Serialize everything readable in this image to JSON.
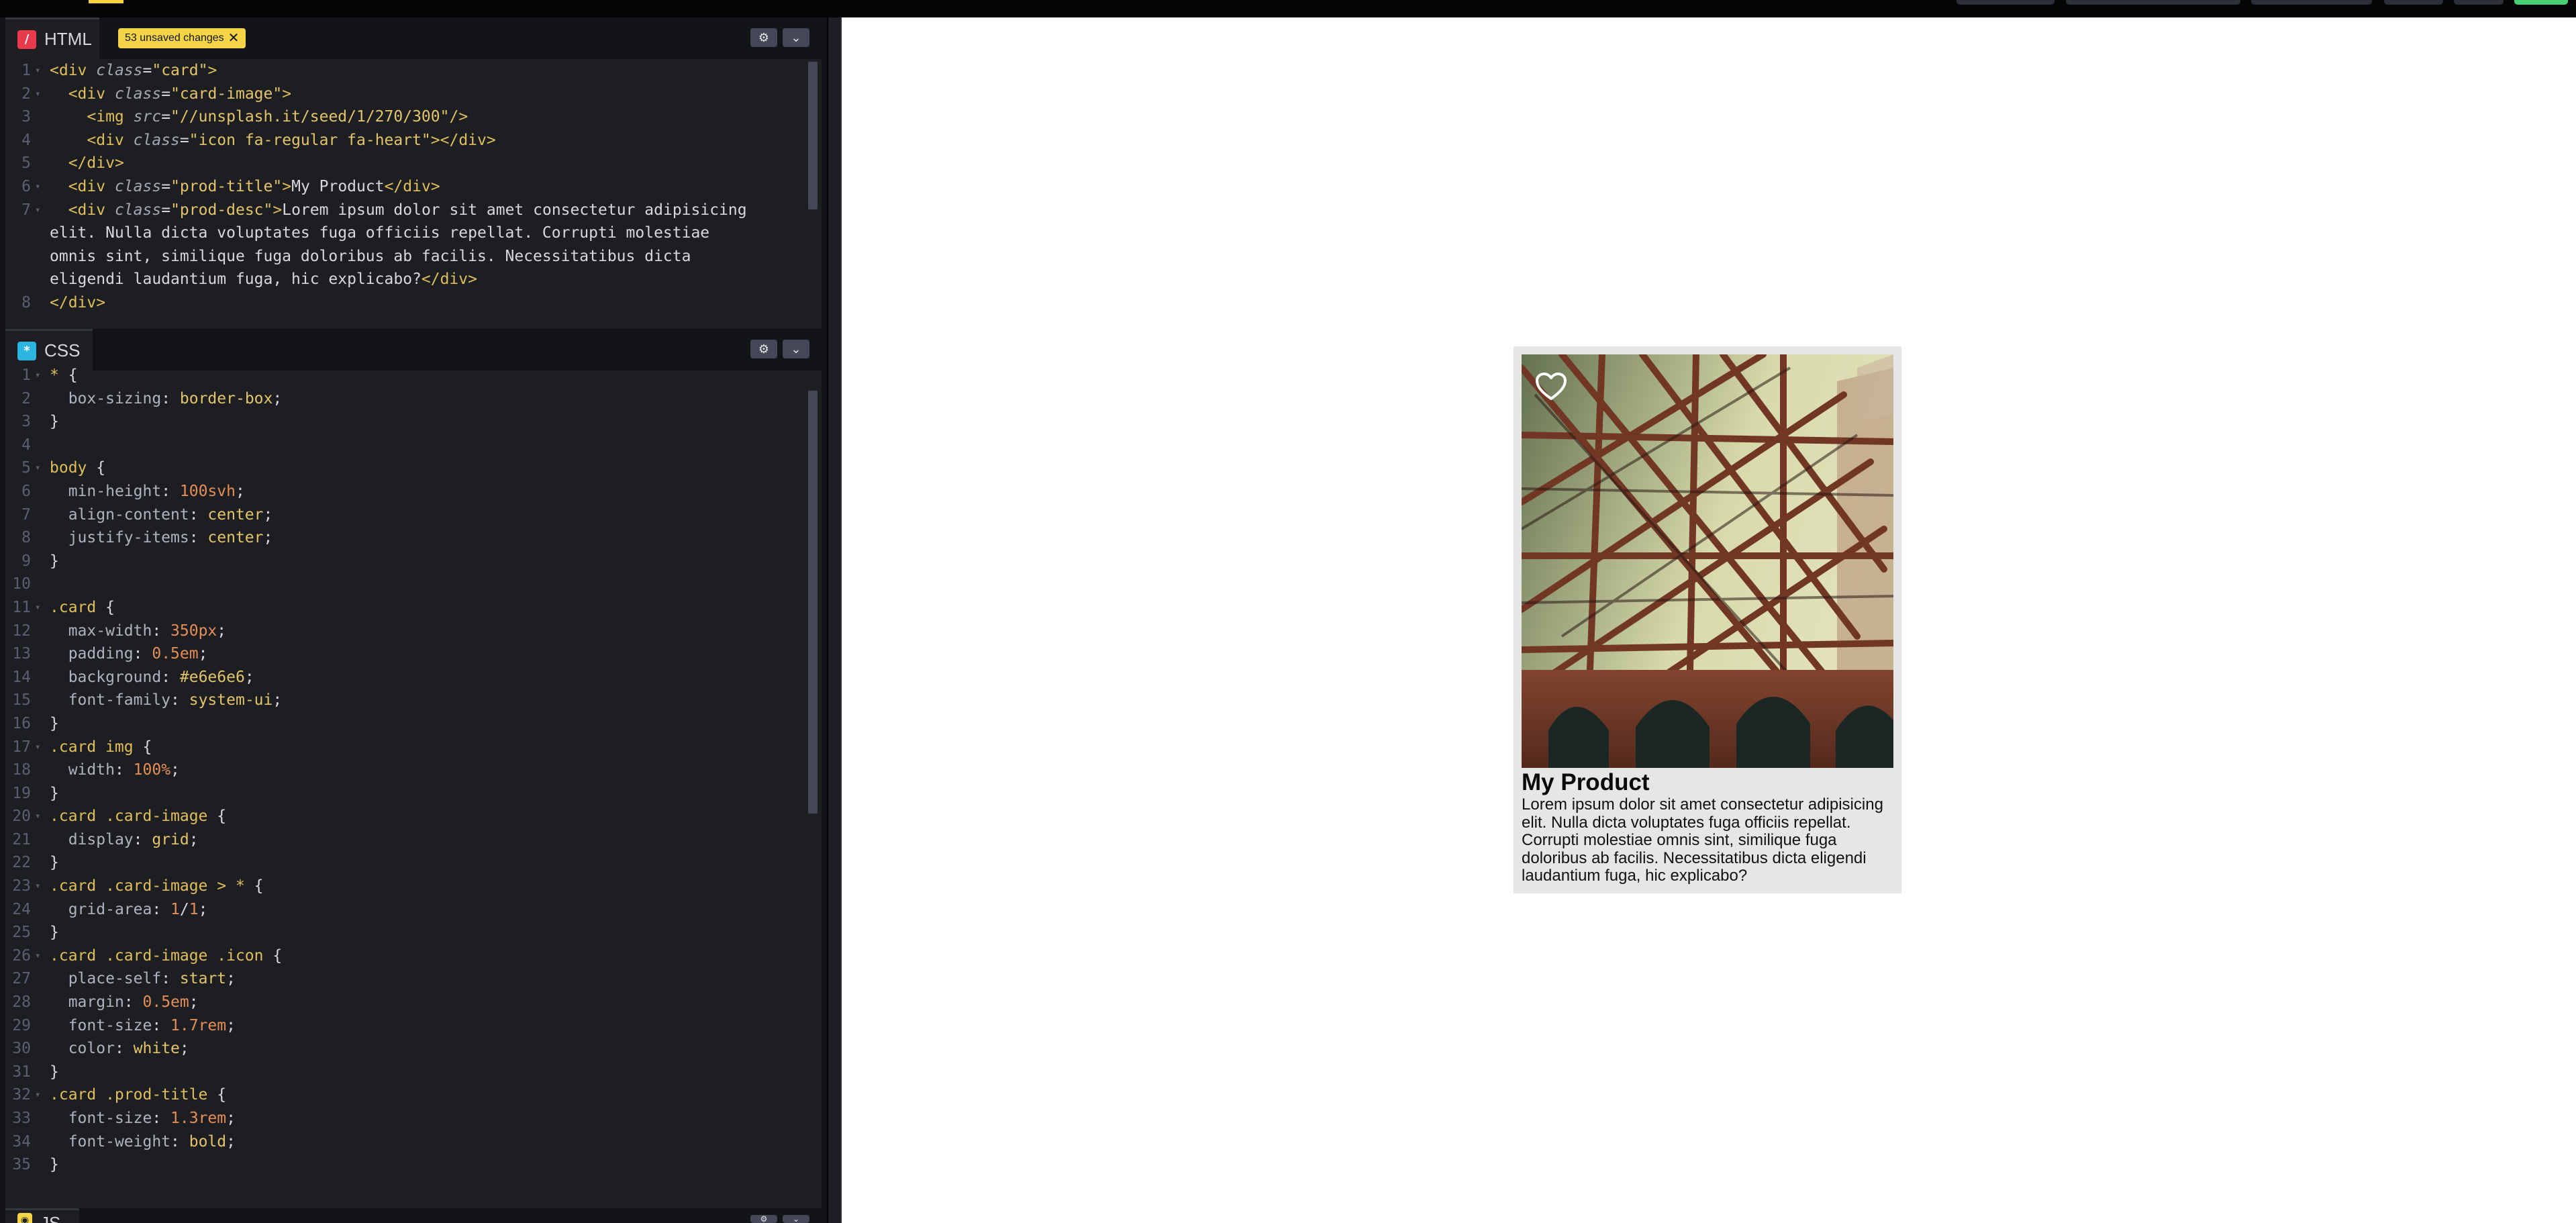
{
  "editors": {
    "html": {
      "name": "HTML",
      "icon": "slash-icon",
      "icon_color": "#e9394c",
      "badge": "53 unsaved changes",
      "badge_close": "✕",
      "lines": [
        "1",
        "2",
        "3",
        "4",
        "5",
        "6",
        "7",
        "",
        "",
        "",
        "8"
      ]
    },
    "css": {
      "name": "CSS",
      "icon": "asterisk-icon",
      "icon_color": "#2bb5e0"
    },
    "js": {
      "name": "JS",
      "icon": "js-icon",
      "icon_color": "#f5d547"
    },
    "settings_glyph": "⚙",
    "collapse_glyph": "⌄"
  },
  "preview": {
    "card": {
      "title": "My Product",
      "description": "Lorem ipsum dolor sit amet consectetur adipisicing elit. Nulla dicta voluptates fuga officiis repellat. Corrupti molestiae omnis sint, similique fuga doloribus ab facilis. Necessitatibus dicta eligendi laudantium fuga, hic explicabo?",
      "image_icon": "heart-icon"
    }
  },
  "code_html": {
    "l1": "<div class=\"card\">",
    "l2": "  <div class=\"card-image\">",
    "l3": "    <img src=\"//unsplash.it/seed/1/270/300\"/>",
    "l4": "    <div class=\"icon fa-regular fa-heart\"></div>",
    "l5": "  </div>",
    "l6": "  <div class=\"prod-title\">My Product</div>",
    "l7a": "  <div class=\"prod-desc\">Lorem ipsum dolor sit amet consectetur adipisicing",
    "l7b": "elit. Nulla dicta voluptates fuga officiis repellat. Corrupti molestiae",
    "l7c": "omnis sint, similique fuga doloribus ab facilis. Necessitatibus dicta",
    "l7d": "eligendi laudantium fuga, hic explicabo?</div>",
    "l8": "</div>"
  },
  "code_css": {
    "c1": "* {",
    "c2": "  box-sizing: border-box;",
    "c3": "}",
    "c4": "",
    "c5": "body {",
    "c6": "  min-height: 100svh;",
    "c7": "  align-content: center;",
    "c8": "  justify-items: center;",
    "c9": "}",
    "c10": "",
    "c11": ".card {",
    "c12": "  max-width: 350px;",
    "c13": "  padding: 0.5em;",
    "c14": "  background: #e6e6e6;",
    "c15": "  font-family: system-ui;",
    "c16": "}",
    "c17": ".card img {",
    "c18": "  width: 100%;",
    "c19": "}",
    "c20": ".card .card-image {",
    "c21": "  display: grid;",
    "c22": "}",
    "c23": ".card .card-image > * {",
    "c24": "  grid-area: 1/1;",
    "c25": "}",
    "c26": ".card .card-image .icon {",
    "c27": "  place-self: start;",
    "c28": "  margin: 0.5em;",
    "c29": "  font-size: 1.7rem;",
    "c30": "  color: white;",
    "c31": "}",
    "c32": ".card .prod-title {",
    "c33": "  font-size: 1.3rem;",
    "c34": "  font-weight: bold;",
    "c35": "}"
  }
}
